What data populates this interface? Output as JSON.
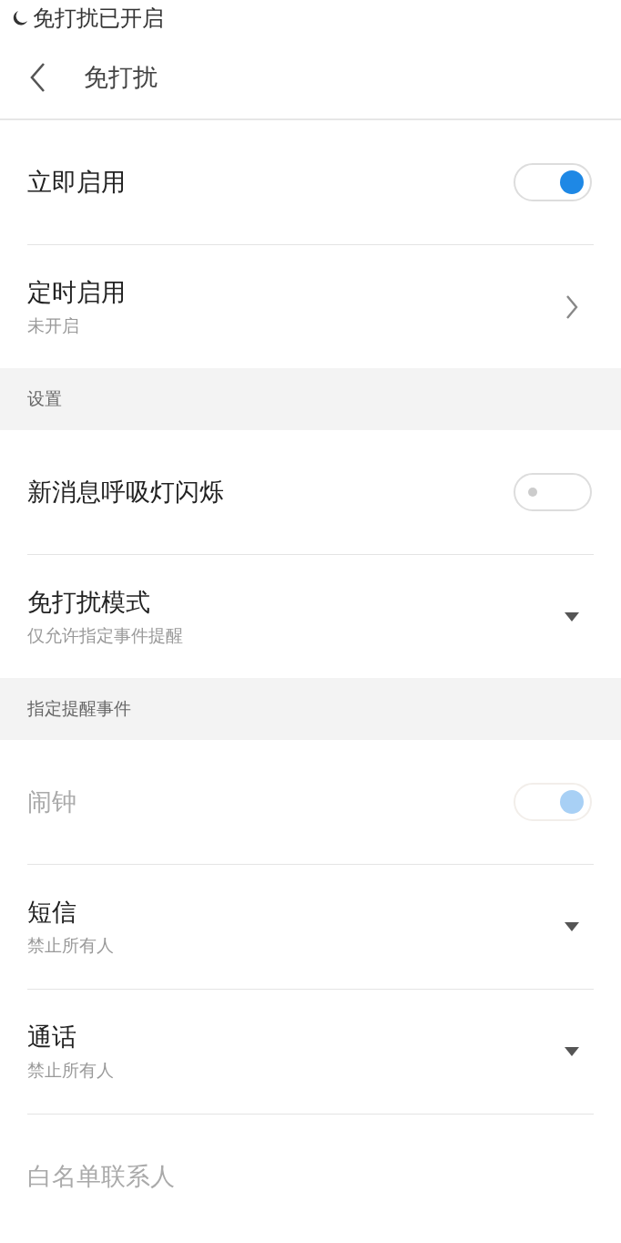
{
  "status_bar": {
    "text": "免打扰已开启"
  },
  "header": {
    "title": "免打扰"
  },
  "sections": [
    {
      "rows": [
        {
          "kind": "toggle",
          "title": "立即启用",
          "on": true,
          "disabled": false
        },
        {
          "kind": "chevron",
          "title": "定时启用",
          "subtitle": "未开启",
          "disabled": false
        }
      ]
    },
    {
      "heading": "设置",
      "rows": [
        {
          "kind": "toggle",
          "title": "新消息呼吸灯闪烁",
          "on": false,
          "disabled": false
        },
        {
          "kind": "dropdown",
          "title": "免打扰模式",
          "subtitle": "仅允许指定事件提醒",
          "disabled": false
        }
      ]
    },
    {
      "heading": "指定提醒事件",
      "rows": [
        {
          "kind": "toggle",
          "title": "闹钟",
          "on": true,
          "disabled": true
        },
        {
          "kind": "dropdown",
          "title": "短信",
          "subtitle": "禁止所有人",
          "disabled": false
        },
        {
          "kind": "dropdown",
          "title": "通话",
          "subtitle": "禁止所有人",
          "disabled": false
        },
        {
          "kind": "plain",
          "title": "白名单联系人",
          "disabled": true
        }
      ]
    }
  ]
}
